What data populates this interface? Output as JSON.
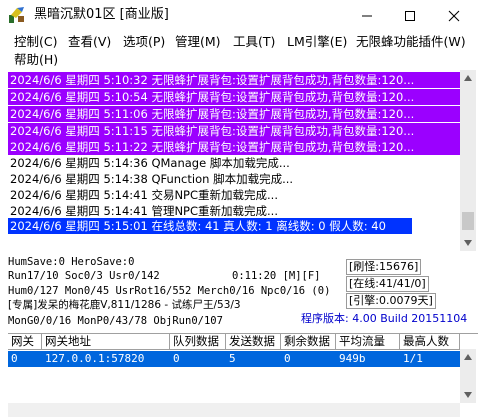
{
  "window": {
    "title": "黑暗沉默01区 [商业版]"
  },
  "menu": [
    {
      "label": "控制(C)"
    },
    {
      "label": "查看(V)"
    },
    {
      "label": "选项(P)"
    },
    {
      "label": "管理(M)"
    },
    {
      "label": "工具(T)"
    },
    {
      "label": "LM引擎(E)"
    },
    {
      "label": "无限蜂功能插件(W)"
    },
    {
      "label": "帮助(H)"
    }
  ],
  "log": [
    {
      "text": "2024/6/6 星期四 5:10:32 无限蜂扩展背包:设置扩展背包成功,背包数量:120...",
      "style": "purple"
    },
    {
      "text": "2024/6/6 星期四 5:10:54 无限蜂扩展背包:设置扩展背包成功,背包数量:120...",
      "style": "purple"
    },
    {
      "text": "2024/6/6 星期四 5:11:06 无限蜂扩展背包:设置扩展背包成功,背包数量:120...",
      "style": "purple"
    },
    {
      "text": "2024/6/6 星期四 5:11:15 无限蜂扩展背包:设置扩展背包成功,背包数量:120...",
      "style": "purple"
    },
    {
      "text": "2024/6/6 星期四 5:11:22 无限蜂扩展背包:设置扩展背包成功,背包数量:120...",
      "style": "purple"
    },
    {
      "text": "2024/6/6 星期四 5:14:36 QManage 脚本加载完成...",
      "style": "plain"
    },
    {
      "text": "2024/6/6 星期四 5:14:38 QFunction 脚本加载完成...",
      "style": "plain"
    },
    {
      "text": "2024/6/6 星期四 5:14:41 交易NPC重新加载完成...",
      "style": "plain"
    },
    {
      "text": "2024/6/6 星期四 5:14:41 管理NPC重新加载完成...",
      "style": "plain"
    },
    {
      "text": "2024/6/6 星期四 5:15:01 在线总数: 41 真人数: 1 离线数: 0 假人数: 40",
      "style": "selected"
    }
  ],
  "status": {
    "humsave": "HumSave:0 HeroSave:0",
    "run": "Run17/10 Soc0/3 Usr0/142",
    "time": "0:11:20 [M][F]",
    "hum": "Hum0/127 Mon0/45 UsrRot16/552 Merch0/16 Npc0/16 (0)",
    "special": "[专属]发呆的梅花鹿V,811/1286 - 试练尸王/53/3",
    "mon": "MonG0/0/16 MonP0/43/78 ObjRun0/107",
    "refresh": "[刷怪:15676]",
    "online": "[在线:41/41/0]",
    "engine": "[引擎:0.0079天]",
    "version": "程序版本: 4.00 Build 20151104"
  },
  "table": {
    "headers": [
      "网关",
      "网关地址",
      "队列数据",
      "发送数据",
      "剩余数据",
      "平均流量",
      "最高人数"
    ],
    "rows": [
      [
        "0",
        "127.0.0.1:57820",
        "0",
        "5",
        "0",
        "949b",
        "1/1"
      ]
    ]
  }
}
